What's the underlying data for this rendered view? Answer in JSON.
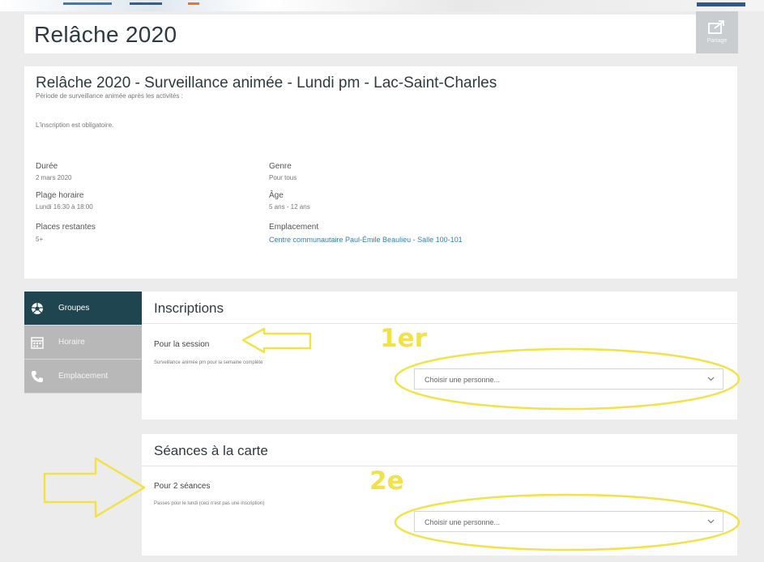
{
  "header": {
    "title": "Relâche 2020",
    "share_label": "Partage"
  },
  "activity": {
    "title": "Relâche 2020 - Surveillance animée - Lundi pm - Lac-Saint-Charles",
    "subtitle": "Période de surveillance animée après les activités :",
    "requirement": "L'inscription est obligatoire.",
    "fields": {
      "duree_label": "Durée",
      "duree_value": "2 mars 2020",
      "plage_label": "Plage horaire",
      "plage_value": "Lundi 16:30 à 18:00",
      "places_label": "Places restantes",
      "places_value": "5+",
      "genre_label": "Genre",
      "genre_value": "Pour tous",
      "age_label": "Âge",
      "age_value": "5 ans - 12 ans",
      "emplacement_label": "Emplacement",
      "emplacement_value": "Centre communautaire Paul-Émile Beaulieu - Salle 100-101"
    }
  },
  "sidebar": {
    "items": [
      {
        "label": "Groupes",
        "icon": "soccer-ball-icon",
        "active": true
      },
      {
        "label": "Horaire",
        "icon": "calendar-icon",
        "active": false
      },
      {
        "label": "Emplacement",
        "icon": "phone-icon",
        "active": false
      }
    ]
  },
  "inscriptions": {
    "heading": "Inscriptions",
    "option_title": "Pour la session",
    "option_desc": "Surveillance animée pm pour la semaine complète",
    "select_value": "Choisir une personne..."
  },
  "seances": {
    "heading": "Séances à la carte",
    "option_title": "Pour 2 séances",
    "option_desc": "Passes pour le lundi (ceci n'est pas une inscription)",
    "select_value": "Choisir une personne..."
  },
  "annotations": {
    "first": "1er",
    "second": "2e",
    "color": "#f1e24a"
  }
}
